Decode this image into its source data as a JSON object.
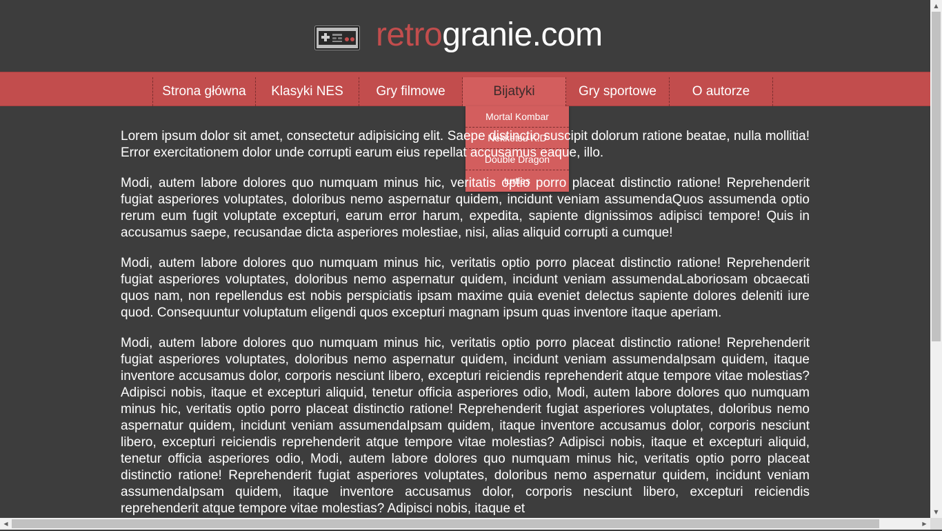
{
  "header": {
    "logo_icon": "nes-controller-icon",
    "title_accent": "retro",
    "title_rest": "granie.com",
    "accent_color": "#c24d4d"
  },
  "nav": {
    "items": [
      {
        "label": "Strona główna"
      },
      {
        "label": "Klasyki NES"
      },
      {
        "label": "Gry filmowe"
      },
      {
        "label": "Bijatyki",
        "active": true
      },
      {
        "label": "Gry sportowe"
      },
      {
        "label": "O autorze"
      }
    ],
    "dropdown": [
      {
        "label": "Mortal Kombar"
      },
      {
        "label": "Nekketsu K.D"
      },
      {
        "label": "Double Dragon"
      },
      {
        "label": "turtles"
      }
    ]
  },
  "content": {
    "paragraphs": [
      "Lorem ipsum dolor sit amet, consectetur adipisicing elit. Saepe distinctio suscipit dolorum ratione beatae, nulla mollitia! Error exercitationem dolor unde corrupti earum eius repellat accusamus eaque, illo.",
      "Modi, autem labore dolores quo numquam minus hic, veritatis optio porro placeat distinctio ratione! Reprehenderit fugiat asperiores voluptates, doloribus nemo aspernatur quidem, incidunt veniam assumendaQuos assumenda optio rerum eum fugit voluptate excepturi, earum error harum, expedita, sapiente dignissimos adipisci tempore! Quis in accusamus saepe, recusandae dicta asperiores molestiae, nisi, alias aliquid corrupti a cumque!",
      "Modi, autem labore dolores quo numquam minus hic, veritatis optio porro placeat distinctio ratione! Reprehenderit fugiat asperiores voluptates, doloribus nemo aspernatur quidem, incidunt veniam assumendaLaboriosam obcaecati quos nam, non repellendus est nobis perspiciatis ipsam maxime quia eveniet delectus sapiente dolores deleniti iure quod. Consequuntur voluptatum eligendi quos excepturi magnam ipsum quas inventore itaque aperiam.",
      "Modi, autem labore dolores quo numquam minus hic, veritatis optio porro placeat distinctio ratione! Reprehenderit fugiat asperiores voluptates, doloribus nemo aspernatur quidem, incidunt veniam assumendaIpsam quidem, itaque inventore accusamus dolor, corporis nesciunt libero, excepturi reiciendis reprehenderit atque tempore vitae molestias? Adipisci nobis, itaque et excepturi aliquid, tenetur officia asperiores odio, Modi, autem labore dolores quo numquam minus hic, veritatis optio porro placeat distinctio ratione! Reprehenderit fugiat asperiores voluptates, doloribus nemo aspernatur quidem, incidunt veniam assumendaIpsam quidem, itaque inventore accusamus dolor, corporis nesciunt libero, excepturi reiciendis reprehenderit atque tempore vitae molestias? Adipisci nobis, itaque et excepturi aliquid, tenetur officia asperiores odio, Modi, autem labore dolores quo numquam minus hic, veritatis optio porro placeat distinctio ratione! Reprehenderit fugiat asperiores voluptates, doloribus nemo aspernatur quidem, incidunt veniam assumendaIpsam quidem, itaque inventore accusamus dolor, corporis nesciunt libero, excepturi reiciendis reprehenderit atque tempore vitae molestias? Adipisci nobis, itaque et"
    ]
  }
}
